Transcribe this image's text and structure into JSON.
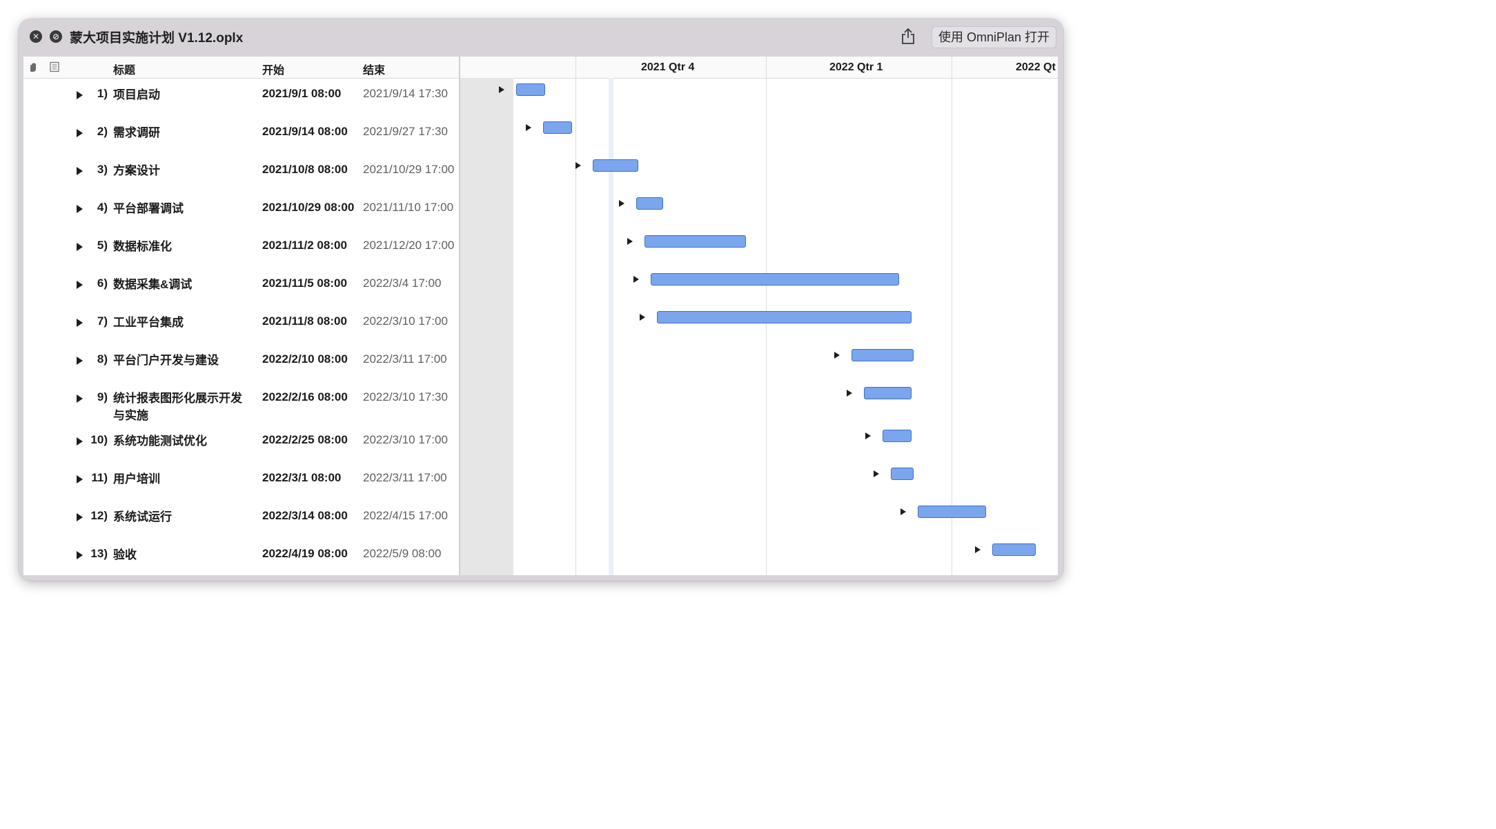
{
  "window": {
    "title": "蒙大项目实施计划 V1.12.oplx",
    "open_button": "使用 OmniPlan 打开",
    "close_glyph": "✕",
    "block_glyph": "⊘"
  },
  "table": {
    "headers": {
      "title": "标题",
      "start": "开始",
      "end": "结束"
    },
    "rows": [
      {
        "num": "1)",
        "title": "项目启动",
        "start": "2021/9/1 08:00",
        "end": "2021/9/14 17:30"
      },
      {
        "num": "2)",
        "title": "需求调研",
        "start": "2021/9/14 08:00",
        "end": "2021/9/27 17:30"
      },
      {
        "num": "3)",
        "title": "方案设计",
        "start": "2021/10/8 08:00",
        "end": "2021/10/29 17:00"
      },
      {
        "num": "4)",
        "title": "平台部署调试",
        "start": "2021/10/29 08:00",
        "end": "2021/11/10 17:00"
      },
      {
        "num": "5)",
        "title": "数据标准化",
        "start": "2021/11/2 08:00",
        "end": "2021/12/20 17:00"
      },
      {
        "num": "6)",
        "title": "数据采集&调试",
        "start": "2021/11/5 08:00",
        "end": "2022/3/4 17:00"
      },
      {
        "num": "7)",
        "title": "工业平台集成",
        "start": "2021/11/8 08:00",
        "end": "2022/3/10 17:00"
      },
      {
        "num": "8)",
        "title": "平台门户开发与建设",
        "start": "2022/2/10 08:00",
        "end": "2022/3/11 17:00"
      },
      {
        "num": "9)",
        "title": "统计报表图形化展示开发与实施",
        "start": "2022/2/16 08:00",
        "end": "2022/3/10 17:30"
      },
      {
        "num": "10)",
        "title": "系统功能测试优化",
        "start": "2022/2/25 08:00",
        "end": "2022/3/10 17:00"
      },
      {
        "num": "11)",
        "title": "用户培训",
        "start": "2022/3/1 08:00",
        "end": "2022/3/11 17:00"
      },
      {
        "num": "12)",
        "title": "系统试运行",
        "start": "2022/3/14 08:00",
        "end": "2022/4/15 17:00"
      },
      {
        "num": "13)",
        "title": "验收",
        "start": "2022/4/19 08:00",
        "end": "2022/5/9 08:00"
      }
    ]
  },
  "gantt": {
    "quarters": [
      "2021 Qtr 4",
      "2022 Qtr 1",
      "2022 Qt"
    ],
    "bar_color": "#7aa6ee",
    "bar_border": "#3e6fc4"
  }
}
